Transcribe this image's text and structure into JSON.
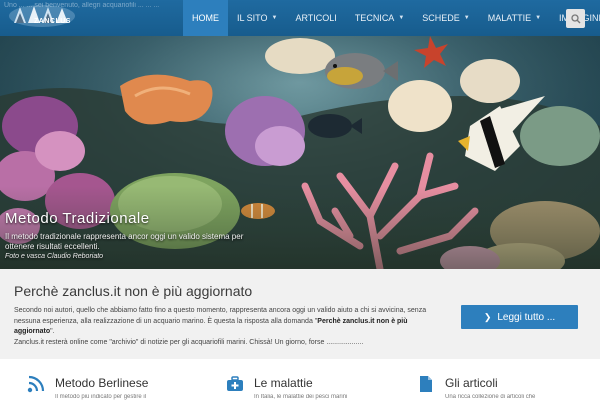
{
  "header": {
    "tagline": "Uno ... ... sei benvenuto, allegri acquariofili ... ... ...",
    "logo_text": "ZANCLUS",
    "nav": [
      {
        "label": "HOME",
        "active": true,
        "has_caret": false
      },
      {
        "label": "IL SITO",
        "active": false,
        "has_caret": true
      },
      {
        "label": "ARTICOLI",
        "active": false,
        "has_caret": false
      },
      {
        "label": "TECNICA",
        "active": false,
        "has_caret": true
      },
      {
        "label": "SCHEDE",
        "active": false,
        "has_caret": true
      },
      {
        "label": "MALATTIE",
        "active": false,
        "has_caret": true
      },
      {
        "label": "IMMAGINI",
        "active": false,
        "has_caret": true
      }
    ],
    "search_icon": "search-icon"
  },
  "hero": {
    "title": "Metodo Tradizionale",
    "description": "Il metodo tradizionale rappresenta ancor oggi un valido sistema per ottenere risultati eccellenti.",
    "credit": "Foto e vasca Claudio Reboriato"
  },
  "notice": {
    "title": "Perchè zanclus.it non è più aggiornato",
    "body_1": "Secondo noi autori, quello che abbiamo fatto fino a questo momento, rappresenta ancora oggi un valido aiuto a chi si avvicina, senza nessuna esperienza, alla realizzazione di un acquario marino. È questa la risposta alla domanda \"",
    "body_bold": "Perchè zanclus.it non è più aggiornato",
    "body_2": "\".",
    "body_3": "Zanclus.it resterà online come \"archivio\" di notizie per gli acquariofili marini. Chissà! Un giorno, forse ...................",
    "button_label": "Leggi tutto ...",
    "button_icon": "chevron-right-icon"
  },
  "features": [
    {
      "title": "Metodo Berlinese",
      "text": "Il metodo più indicato per gestire il",
      "icon": "rss-icon"
    },
    {
      "title": "Le malattie",
      "text": "In Italia, le malattie dei pesci marini",
      "icon": "medical-kit-icon"
    },
    {
      "title": "Gli articoli",
      "text": "Una ricca collezione di articoli che",
      "icon": "document-icon"
    }
  ],
  "colors": {
    "brand_blue": "#1f6aa0",
    "accent_blue": "#2d7fbd"
  }
}
